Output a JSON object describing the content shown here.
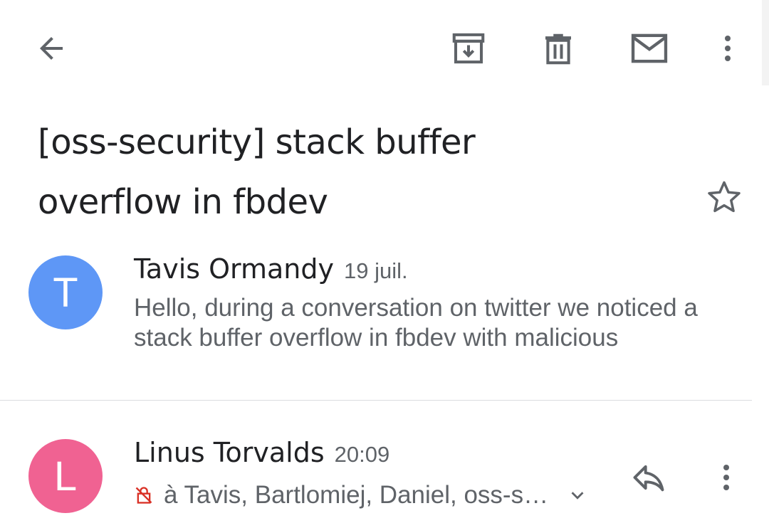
{
  "toolbar": {
    "icons": [
      "back-arrow-icon",
      "archive-icon",
      "delete-icon",
      "mark-unread-icon",
      "more-vert-icon"
    ]
  },
  "thread": {
    "subject": "[oss-security] stack buffer overflow in fbdev",
    "starred": false
  },
  "messages": [
    {
      "avatar_letter": "T",
      "avatar_color": "#5e97f6",
      "sender": "Tavis Ormandy",
      "date": "19 juil.",
      "snippet": "Hello, during a conversation on twitter we noticed a stack buffer overflow in fbdev with malicious"
    },
    {
      "avatar_letter": "L",
      "avatar_color": "#f06292",
      "sender": "Linus Torvalds",
      "date": "20:09",
      "recipients": "à Tavis, Bartlomiej, Daniel, oss-s…",
      "recipients_icon": "lock-off-icon"
    }
  ],
  "colors": {
    "icon": "#5f6368",
    "text_primary": "#202124",
    "text_secondary": "#5f6368",
    "lock_red": "#d93025",
    "divider": "#dadce0"
  }
}
